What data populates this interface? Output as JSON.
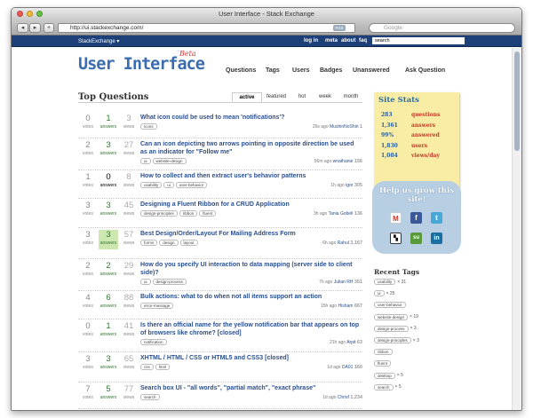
{
  "browser": {
    "title": "User Interface - Stack Exchange",
    "url": "http://ui.stackexchange.com/",
    "search_placeholder": "Google"
  },
  "sebar": {
    "logo": "StackExchange ▾",
    "links": [
      "log in",
      "meta",
      "about",
      "faq"
    ],
    "search": "search"
  },
  "site": {
    "title": "User Interface",
    "beta": "Beta",
    "nav": [
      "Questions",
      "Tags",
      "Users",
      "Badges",
      "Unanswered",
      "Ask Question"
    ]
  },
  "top": {
    "heading": "Top Questions",
    "tabs": [
      "active",
      "featured",
      "hot",
      "week",
      "month"
    ]
  },
  "questions": [
    {
      "votes": "0",
      "answers": "1",
      "views": "3",
      "title": "What icon could be used to mean 'notifications'?",
      "tags": [
        "icons"
      ],
      "time": "26s ago",
      "user": "MushinNoShin",
      "rep": "1"
    },
    {
      "votes": "2",
      "answers": "3",
      "views": "27",
      "title": "Can an icon depicting two arrows pointing in opposite direction be used as an indicator for \"Follow me\"",
      "tags": [
        "ui",
        "website-design"
      ],
      "time": "56m ago",
      "user": "wnathanie",
      "rep": "156"
    },
    {
      "votes": "1",
      "answers": "0",
      "views": "8",
      "title": "How to collect and then extract user's behavior patterns",
      "tags": [
        "usability",
        "ui",
        "user-behavior"
      ],
      "time": "1h ago",
      "user": "igor",
      "rep": "305"
    },
    {
      "votes": "3",
      "answers": "3",
      "views": "45",
      "title": "Designing a Fluent Ribbon for a CRUD Application",
      "tags": [
        "design-principles",
        "ribbon",
        "fluent"
      ],
      "time": "3h ago",
      "user": "Tania Gobeli",
      "rep": "136"
    },
    {
      "votes": "3",
      "answers": "3",
      "views": "57",
      "title": "Best Design/Order/Layout For Mailing Address Form",
      "tags": [
        "forms",
        "design",
        "layout"
      ],
      "time": "6h ago",
      "user": "Rahul",
      "rep": "3,167"
    },
    {
      "votes": "2",
      "answers": "2",
      "views": "29",
      "title": "How do you specify UI interaction to data mapping (server side to client side)?",
      "tags": [
        "ui",
        "design-process"
      ],
      "time": "7h ago",
      "user": "Julian RH",
      "rep": "351"
    },
    {
      "votes": "4",
      "answers": "6",
      "views": "88",
      "title": "Bulk actions: what to do when not all items support an action",
      "tags": [
        "error-message"
      ],
      "time": "15h ago",
      "user": "Hisham",
      "rep": "667"
    },
    {
      "votes": "0",
      "answers": "1",
      "views": "41",
      "title": "Is there an official name for the yellow notification bar that appears on top of browsers like chrome? [closed]",
      "tags": [
        "notification"
      ],
      "time": "21h ago",
      "user": "Arpit",
      "rep": "63"
    },
    {
      "votes": "3",
      "answers": "3",
      "views": "65",
      "title": "XHTML / HTML / CSS or HTML5 and CSS3 [closed]",
      "tags": [
        "css",
        "html"
      ],
      "time": "1d ago",
      "user": "DA01",
      "rep": "160"
    },
    {
      "votes": "7",
      "answers": "5",
      "views": "77",
      "title": "Search box UI - \"all words\", \"partial match\", \"exact phrase\"",
      "tags": [
        "search"
      ],
      "time": "1d ago",
      "user": "Chrisf",
      "rep": "1,234"
    }
  ],
  "labels": {
    "votes": "votes",
    "answers": "answers",
    "views": "views"
  },
  "stats": {
    "title": "Site Stats",
    "rows": [
      {
        "v": "283",
        "k": "questions"
      },
      {
        "v": "1,361",
        "k": "answers"
      },
      {
        "v": "99%",
        "k": "answered"
      },
      {
        "v": "1,830",
        "k": "users"
      },
      {
        "v": "1,084",
        "k": "views/day"
      }
    ]
  },
  "grow": {
    "title": "Help us grow this site!",
    "icons": [
      "gmail-icon",
      "facebook-icon",
      "twitter-icon",
      "delicious-icon",
      "stumbleupon-icon",
      "linkedin-icon"
    ]
  },
  "recent": {
    "title": "Recent Tags",
    "tags": [
      {
        "t": "usability",
        "c": "× 31"
      },
      {
        "t": "ui",
        "c": "× 25"
      },
      {
        "t": "user-behavior",
        "c": ""
      },
      {
        "t": "website-design",
        "c": "× 19"
      },
      {
        "t": "design-process",
        "c": "× 3"
      },
      {
        "t": "design-principles",
        "c": "× 3"
      },
      {
        "t": "ribbon",
        "c": ""
      },
      {
        "t": "fluent",
        "c": ""
      },
      {
        "t": "desktop",
        "c": "× 5"
      },
      {
        "t": "search",
        "c": "× 5"
      }
    ]
  },
  "colors": {
    "accepted_answer_bg": "#cde7b0",
    "answered": "#2f7a2f",
    "brand": "#3c6cb0"
  }
}
